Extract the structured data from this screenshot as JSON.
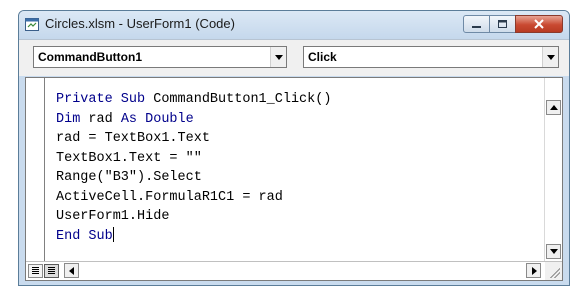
{
  "window": {
    "title": "Circles.xlsm - UserForm1 (Code)",
    "icons": {
      "app": "vba-code-window-icon",
      "minimize": "minimize-icon",
      "maximize": "maximize-icon",
      "close": "close-icon"
    }
  },
  "dropdowns": {
    "object": {
      "selected": "CommandButton1"
    },
    "procedure": {
      "selected": "Click"
    }
  },
  "code": {
    "line_1": {
      "kw1": "Private Sub",
      "rest": " CommandButton1_Click()"
    },
    "line_2": {
      "kw1": "Dim",
      "mid": " rad ",
      "kw2": "As Double"
    },
    "line_3": "rad = TextBox1.Text",
    "line_4": "TextBox1.Text = \"\"",
    "line_5": "Range(\"B3\").Select",
    "line_6": "ActiveCell.FormulaR1C1 = rad",
    "line_7": "UserForm1.Hide",
    "line_8": {
      "kw1": "End Sub"
    }
  },
  "colors": {
    "keyword": "#00008b",
    "text": "#000000",
    "close_button": "#c94a32"
  }
}
